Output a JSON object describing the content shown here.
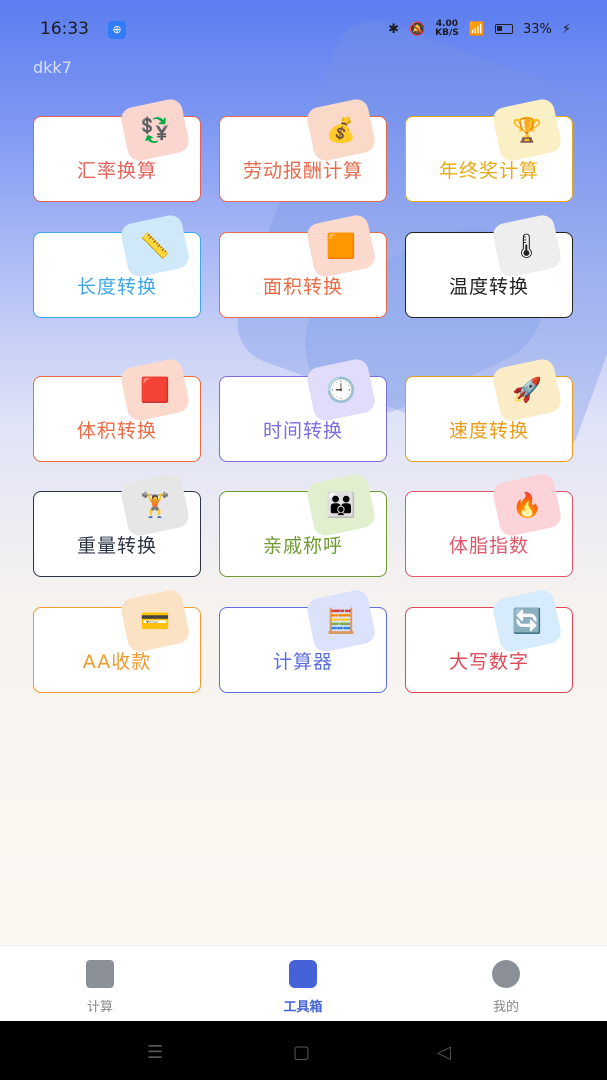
{
  "status": {
    "time": "16:33",
    "speed_top": "4.00",
    "speed_bottom": "KB/S",
    "battery": "33%"
  },
  "user": {
    "name": "dkk7"
  },
  "tools": [
    {
      "label": "汇率换算",
      "color": "#e4605a",
      "icon": "money-exchange-icon",
      "glyph": "💱",
      "icon_bg": "#fbd6cf"
    },
    {
      "label": "劳动报酬计算",
      "color": "#e46c4f",
      "icon": "money-bag-icon",
      "glyph": "💰",
      "icon_bg": "#fbd9c9"
    },
    {
      "label": "年终奖计算",
      "color": "#e6a917",
      "icon": "trophy-icon",
      "glyph": "🏆",
      "icon_bg": "#fbefc6"
    },
    {
      "label": "长度转换",
      "color": "#3ea7e8",
      "icon": "ruler-icon",
      "glyph": "📏",
      "icon_bg": "#cfe9fb"
    },
    {
      "label": "面积转换",
      "color": "#ec6a44",
      "icon": "square-icon",
      "glyph": "🟧",
      "icon_bg": "#fbd9cd"
    },
    {
      "label": "温度转换",
      "color": "#222222",
      "icon": "thermometer-icon",
      "glyph": "🌡",
      "icon_bg": "#eeeeee"
    },
    {
      "label": "体积转换",
      "color": "#ec6a44",
      "icon": "cube-icon",
      "glyph": "🟥",
      "icon_bg": "#fbd9cd"
    },
    {
      "label": "时间转换",
      "color": "#7a6ee2",
      "icon": "clock-icon",
      "glyph": "🕘",
      "icon_bg": "#e2dcfb"
    },
    {
      "label": "速度转换",
      "color": "#ea9b19",
      "icon": "rocket-icon",
      "glyph": "🚀",
      "icon_bg": "#fbecc8"
    },
    {
      "label": "重量转换",
      "color": "#2b3444",
      "icon": "kettlebell-icon",
      "glyph": "🏋",
      "icon_bg": "#e6e6e6"
    },
    {
      "label": "亲戚称呼",
      "color": "#6e9a2f",
      "icon": "people-icon",
      "glyph": "👪",
      "icon_bg": "#e2efcf"
    },
    {
      "label": "体脂指数",
      "color": "#e0566a",
      "icon": "kcal-icon",
      "glyph": "🔥",
      "icon_bg": "#fbd3d9"
    },
    {
      "label": "AA收款",
      "color": "#ee9a2c",
      "icon": "payment-icon",
      "glyph": "💳",
      "icon_bg": "#fbe2c4"
    },
    {
      "label": "计算器",
      "color": "#5d6fe0",
      "icon": "calculator-icon",
      "glyph": "🧮",
      "icon_bg": "#dce2fb"
    },
    {
      "label": "大写数字",
      "color": "#df4757",
      "icon": "swap-icon",
      "glyph": "🔄",
      "icon_bg": "#d6ebfb"
    }
  ],
  "tabs": [
    {
      "label": "计算"
    },
    {
      "label": "工具箱"
    },
    {
      "label": "我的"
    }
  ]
}
